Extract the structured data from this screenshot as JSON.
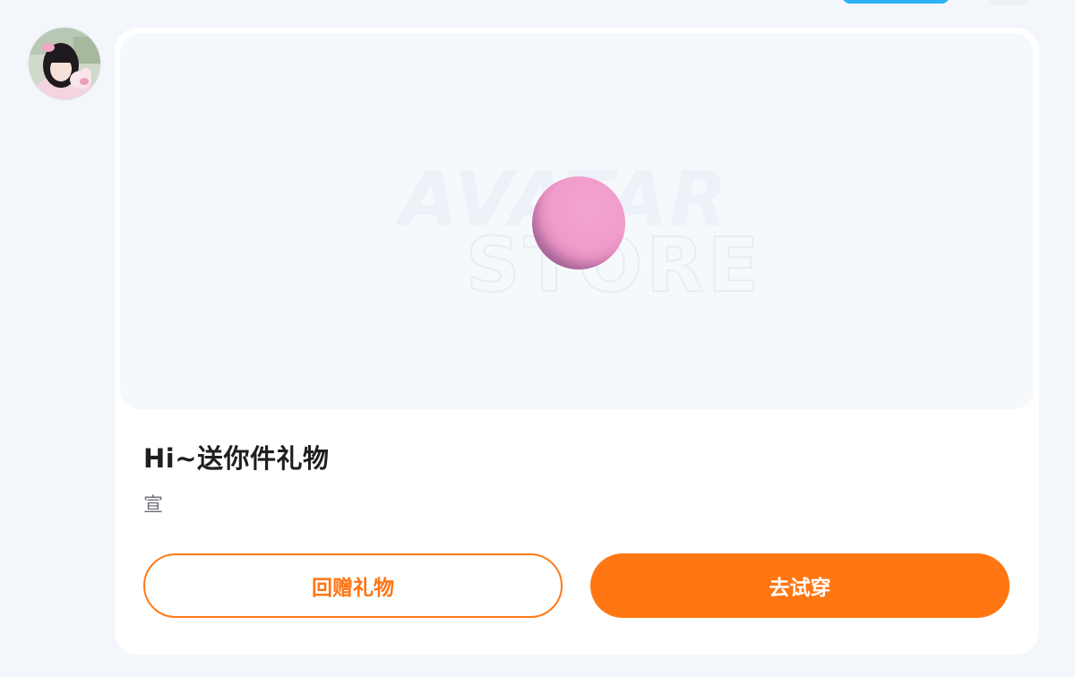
{
  "message": {
    "title": "Hi~送你件礼物",
    "sender_name": "宣"
  },
  "preview": {
    "watermark_line1": "AVATAR",
    "watermark_line2": "STORE",
    "item_color": "#f09ccb"
  },
  "actions": {
    "return_gift_label": "回赠礼物",
    "try_on_label": "去试穿"
  },
  "colors": {
    "accent": "#ff7612",
    "top_pill": "#2bb3f3"
  }
}
